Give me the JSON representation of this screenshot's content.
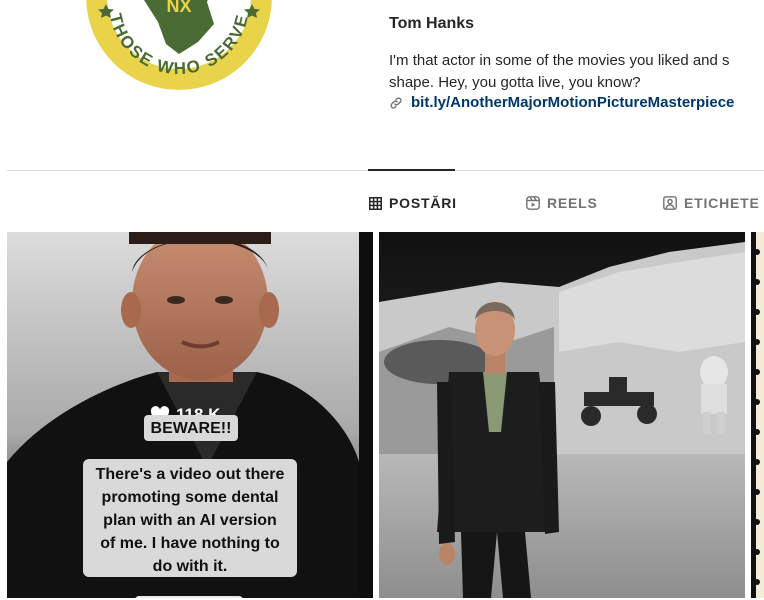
{
  "profile": {
    "logo_text_top": "NX",
    "logo_text_ring": "THOSE WHO SERVE",
    "display_name": "Tom Hanks",
    "bio_lines": [
      "I'm that actor in some of the movies you liked and s",
      "shape. Hey, you gotta live, you know?"
    ],
    "link": "bit.ly/AnotherMajorMotionPictureMasterpiece"
  },
  "tabs": [
    {
      "label": "POSTĂRI",
      "icon": "grid-icon",
      "active": true
    },
    {
      "label": "REELS",
      "icon": "reels-icon",
      "active": false
    },
    {
      "label": "ETICHETE",
      "icon": "tagged-icon",
      "active": false
    }
  ],
  "posts": [
    {
      "likes": "118 K",
      "overlay_title": "BEWARE!!",
      "overlay_lines": [
        "There's a video out there",
        "promoting some dental",
        "plan with an AI version",
        "of me.  I have nothing to",
        "do with it."
      ]
    },
    {
      "description": ""
    },
    {
      "description": ""
    }
  ],
  "colors": {
    "link": "#00376b",
    "text": "#262626",
    "muted": "#737373",
    "divider": "#dbdbdb",
    "logo_gold": "#e8d34a",
    "logo_green": "#4a6b33"
  }
}
